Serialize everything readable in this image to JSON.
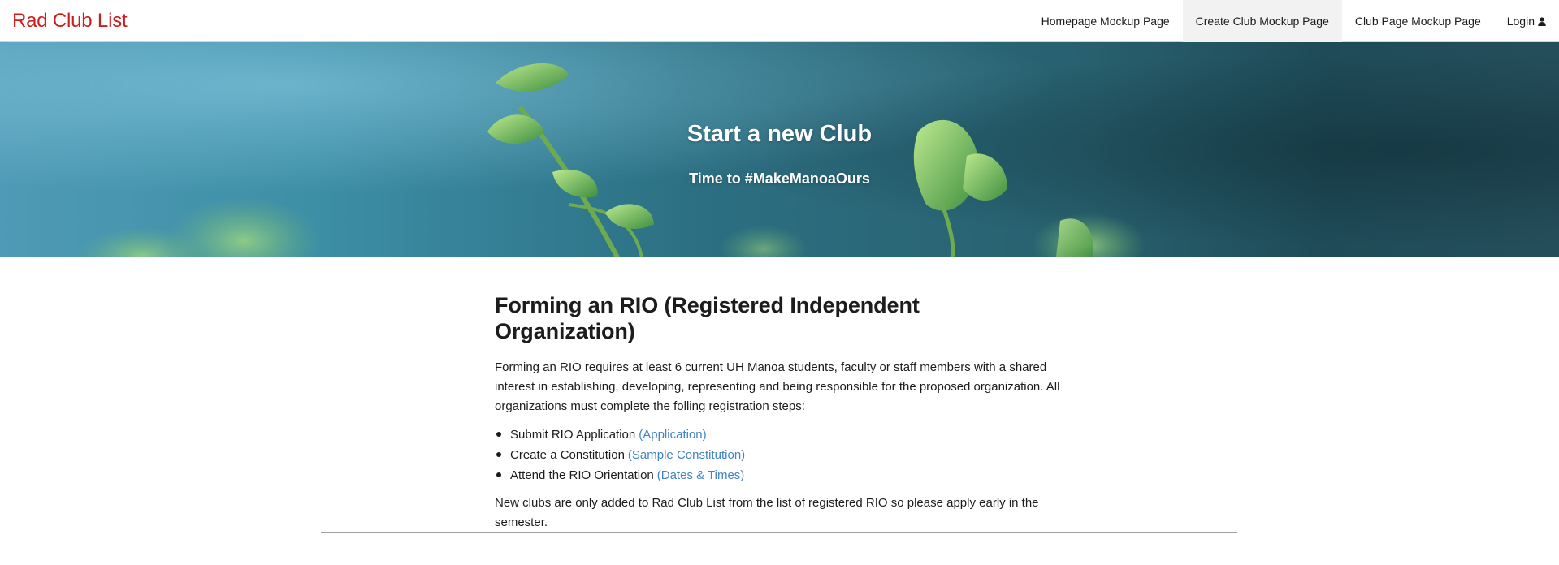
{
  "app": {
    "brand": "Rad Club List",
    "brand_color": "#c8201d"
  },
  "menu": {
    "items": [
      {
        "label": "Homepage Mockup Page",
        "active": false
      },
      {
        "label": "Create Club Mockup Page",
        "active": true
      },
      {
        "label": "Club Page Mockup Page",
        "active": false
      },
      {
        "label": "Login",
        "active": false,
        "icon": "user-icon"
      }
    ]
  },
  "hero": {
    "title": "Start a new Club",
    "subtitle": "Time to #MakeManoaOurs"
  },
  "main": {
    "heading": "Forming an RIO (Registered Independent Organization)",
    "intro": "Forming an RIO requires at least 6 current UH Manoa students, faculty or staff members with a shared interest in establishing, developing, representing and being responsible for the proposed organization. All organizations must complete the folling registration steps:",
    "steps": [
      {
        "text": "Submit RIO Application",
        "link": "(Application)"
      },
      {
        "text": "Create a Constitution",
        "link": "(Sample Constitution)"
      },
      {
        "text": "Attend the RIO Orientation",
        "link": "(Dates & Times)"
      }
    ],
    "note": "New clubs are only added to Rad Club List from the list of registered RIO so please apply early in the semester.",
    "link_color": "#4183c4"
  }
}
